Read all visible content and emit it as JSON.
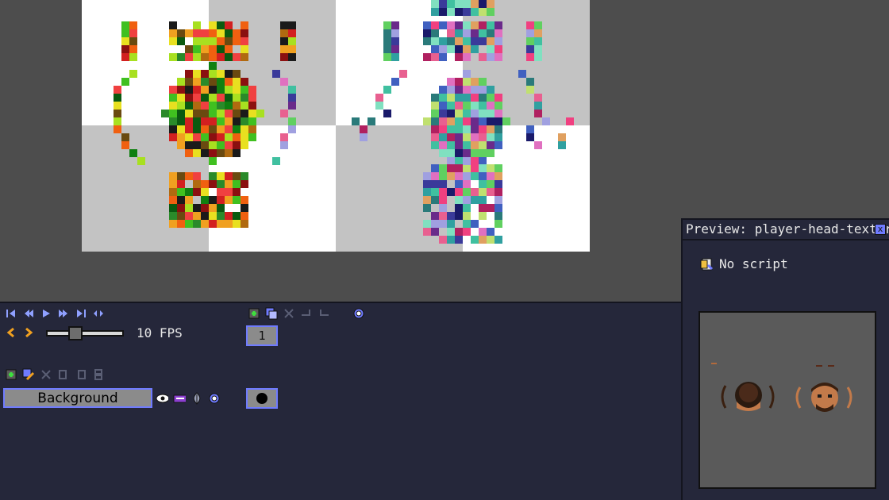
{
  "timeline": {
    "fps_label": "10 FPS",
    "fps_value": 10,
    "frames": [
      {
        "label": "1"
      }
    ]
  },
  "layers": [
    {
      "name": "Background",
      "visible": true
    }
  ],
  "preview": {
    "title": "Preview: player-head-texture",
    "close_label": "x",
    "script_status": "No script"
  },
  "colors": {
    "panel_bg": "#25273a",
    "canvas_bg": "#4d4d4d",
    "accent": "#6f7bff",
    "checker_light": "#ffffff",
    "checker_dark": "#c3c3c3"
  }
}
